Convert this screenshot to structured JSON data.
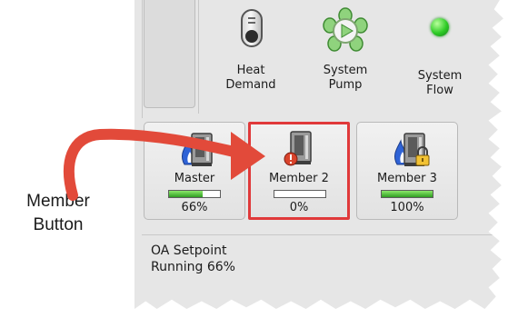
{
  "status": {
    "heat_demand": {
      "label": "Heat\nDemand",
      "icon": "thermostat-icon"
    },
    "system_pump": {
      "label": "System\nPump",
      "icon": "pump-icon"
    },
    "system_flow": {
      "label": "System\nFlow",
      "icon": "green-status-light-icon"
    }
  },
  "boilers": [
    {
      "name": "Master",
      "percent_text": "66%",
      "level": 0.66,
      "icon": "boiler-flame-icon",
      "selected": false
    },
    {
      "name": "Member 2",
      "percent_text": "0%",
      "level": 0.0,
      "icon": "boiler-warning-icon",
      "selected": true
    },
    {
      "name": "Member 3",
      "percent_text": "100%",
      "level": 1.0,
      "icon": "boiler-locked-flame-icon",
      "selected": false
    }
  ],
  "info": {
    "line1": "OA Setpoint",
    "line2": "Running 66%"
  },
  "callout": {
    "text": "Member\nButton"
  },
  "colors": {
    "accent_red": "#e0393a",
    "meter_green": "#2f9d21",
    "flow_green": "#2ecb26",
    "flame_blue": "#2f63d6"
  }
}
